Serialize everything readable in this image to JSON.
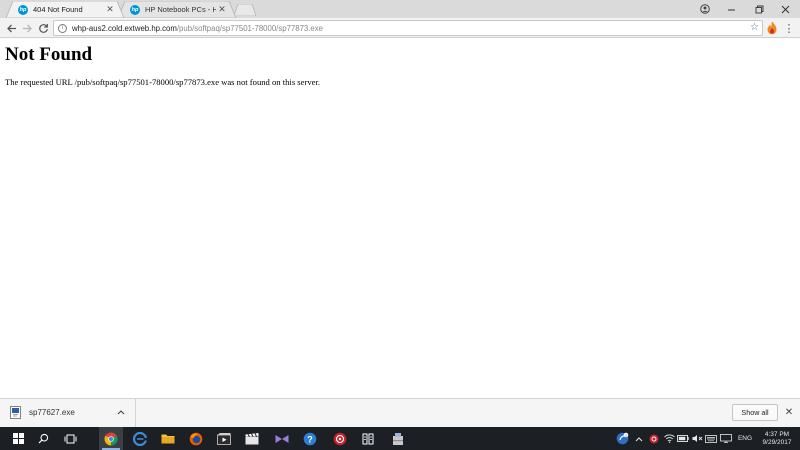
{
  "browser": {
    "tabs": [
      {
        "title": "404 Not Found",
        "favicon": "hp-icon",
        "active": true
      },
      {
        "title": "HP Notebook PCs - How",
        "favicon": "hp-icon",
        "active": false
      }
    ],
    "address": {
      "host": "whp-aus2.cold.extweb.hp.com",
      "path": "/pub/softpaq/sp77501-78000/sp77873.exe"
    }
  },
  "page": {
    "heading": "Not Found",
    "message": "The requested URL /pub/softpaq/sp77501-78000/sp77873.exe was not found on this server."
  },
  "downloads": {
    "file_name": "sp77627.exe",
    "show_all_label": "Show all"
  },
  "taskbar": {
    "language": "ENG",
    "time": "4:37 PM",
    "date": "9/29/2017"
  },
  "colors": {
    "hp_blue": "#0096d6",
    "taskbar_bg": "#1c1f24",
    "tabstrip_bg": "#dadada"
  }
}
